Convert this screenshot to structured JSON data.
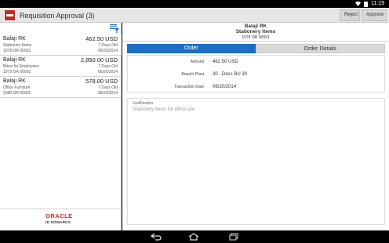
{
  "status_bar": {
    "time": "11:19"
  },
  "action_bar": {
    "title": "Requisition Approval (3)",
    "reject_label": "Reject",
    "approve_label": "Approve"
  },
  "list": [
    {
      "name": "Balaji RK",
      "amount": "462.50 USD",
      "description": "Stationery Items",
      "age": "7 Days Old",
      "order": "1078 OR 00001",
      "date": "06/20/2014"
    },
    {
      "name": "Balaji RK",
      "amount": "2,850.00 USD",
      "description": "Bikes for Employees",
      "age": "7 Days Old",
      "order": "1079 OR 00001",
      "date": "06/20/2014"
    },
    {
      "name": "Balaji RK",
      "amount": "578.00 USD",
      "description": "Office Furniture",
      "age": "7 Days Old",
      "order": "1080 OR 00001",
      "date": "06/20/2014"
    }
  ],
  "branding": {
    "oracle": "ORACLE",
    "jde": "JD EDWARDS"
  },
  "detail": {
    "name": "Balaji RK",
    "description": "Stationery Items",
    "order": "1078 OR 00001",
    "tabs": [
      {
        "label": "Order",
        "active": true
      },
      {
        "label": "Order Details",
        "active": false
      }
    ],
    "fields": [
      {
        "label": "Amount",
        "value": "462.50 USD"
      },
      {
        "label": "Branch Plant",
        "value": "30 - Desc BU 30"
      },
      {
        "label": "Transaction Date",
        "value": "06/20/2014"
      }
    ],
    "justification_label": "Justification",
    "justification_text": "Stationery Items for office use"
  },
  "colors": {
    "accent": "#1c6fc4",
    "brand_red": "#d0281f"
  }
}
